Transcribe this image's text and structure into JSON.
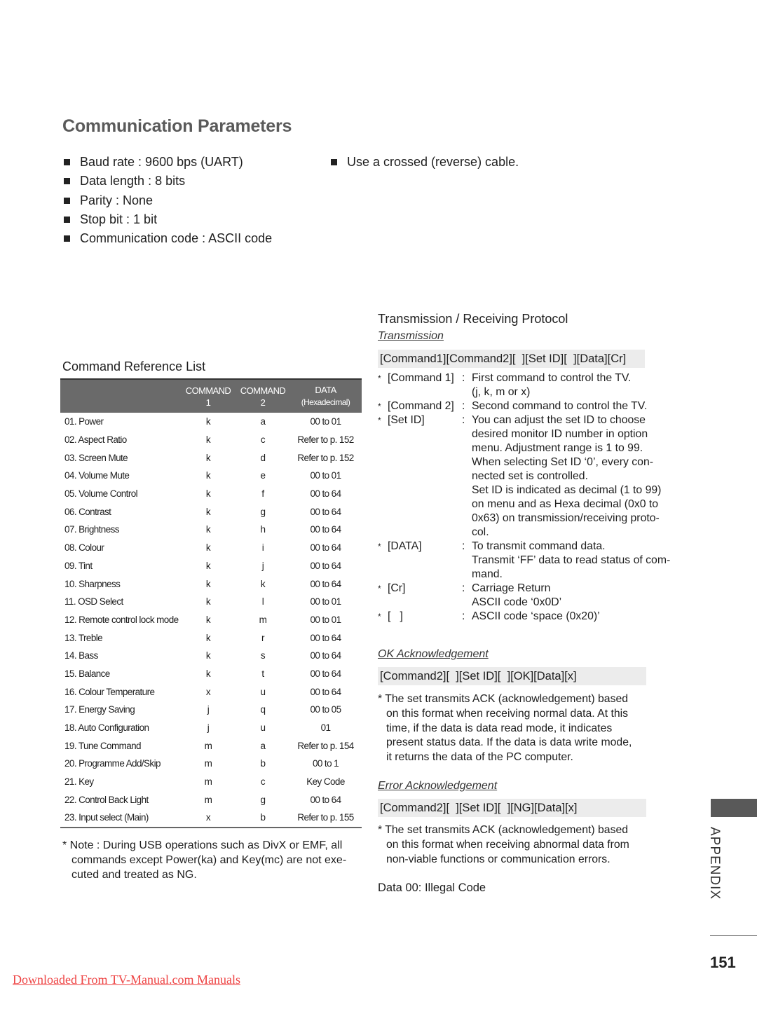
{
  "page": {
    "title": "Communication Parameters",
    "params": [
      "Baud rate : 9600 bps (UART)",
      "Data length : 8 bits",
      "Parity : None",
      "Stop bit : 1 bit",
      "Communication code : ASCII code"
    ],
    "cable_note": "Use a crossed (reverse) cable."
  },
  "command_reference": {
    "title": "Command Reference List",
    "headers": {
      "col0": "",
      "cmd1_line1": "COMMAND",
      "cmd1_line2": "1",
      "cmd2_line1": "COMMAND",
      "cmd2_line2": "2",
      "data_line1": "DATA",
      "data_line2": "(Hexadecimal)"
    },
    "rows": [
      {
        "name": "01. Power",
        "cmd1": "k",
        "cmd2": "a",
        "data": "00 to 01"
      },
      {
        "name": "02. Aspect Ratio",
        "cmd1": "k",
        "cmd2": "c",
        "data": "Refer to p. 152"
      },
      {
        "name": "03. Screen Mute",
        "cmd1": "k",
        "cmd2": "d",
        "data": "Refer to p. 152"
      },
      {
        "name": "04. Volume Mute",
        "cmd1": "k",
        "cmd2": "e",
        "data": "00 to 01"
      },
      {
        "name": "05. Volume Control",
        "cmd1": "k",
        "cmd2": "f",
        "data": "00 to 64"
      },
      {
        "name": "06. Contrast",
        "cmd1": "k",
        "cmd2": "g",
        "data": "00 to 64"
      },
      {
        "name": "07. Brightness",
        "cmd1": "k",
        "cmd2": "h",
        "data": "00 to 64"
      },
      {
        "name": "08. Colour",
        "cmd1": "k",
        "cmd2": "i",
        "data": "00 to 64"
      },
      {
        "name": "09. Tint",
        "cmd1": "k",
        "cmd2": "j",
        "data": "00 to 64"
      },
      {
        "name": "10. Sharpness",
        "cmd1": "k",
        "cmd2": "k",
        "data": "00 to 64"
      },
      {
        "name": "11. OSD Select",
        "cmd1": "k",
        "cmd2": "l",
        "data": "00 to 01"
      },
      {
        "name": "12. Remote control lock mode",
        "cmd1": "k",
        "cmd2": "m",
        "data": "00 to 01"
      },
      {
        "name": "13. Treble",
        "cmd1": "k",
        "cmd2": "r",
        "data": "00 to 64"
      },
      {
        "name": "14. Bass",
        "cmd1": "k",
        "cmd2": "s",
        "data": "00 to 64"
      },
      {
        "name": "15. Balance",
        "cmd1": "k",
        "cmd2": "t",
        "data": "00 to 64"
      },
      {
        "name": "16. Colour Temperature",
        "cmd1": "x",
        "cmd2": "u",
        "data": "00 to 64"
      },
      {
        "name": "17. Energy Saving",
        "cmd1": "j",
        "cmd2": "q",
        "data": "00 to 05"
      },
      {
        "name": "18. Auto Configuration",
        "cmd1": "j",
        "cmd2": "u",
        "data": "01"
      },
      {
        "name": "19. Tune Command",
        "cmd1": "m",
        "cmd2": "a",
        "data": "Refer to p. 154"
      },
      {
        "name": "20. Programme Add/Skip",
        "cmd1": "m",
        "cmd2": "b",
        "data": "00 to 1"
      },
      {
        "name": "21. Key",
        "cmd1": "m",
        "cmd2": "c",
        "data": "Key Code"
      },
      {
        "name": "22. Control Back Light",
        "cmd1": "m",
        "cmd2": "g",
        "data": "00 to 64"
      },
      {
        "name": "23. Input select (Main)",
        "cmd1": "x",
        "cmd2": "b",
        "data": "Refer to p. 155"
      }
    ],
    "note_line1": "* Note : During USB operations such as DivX or EMF, all",
    "note_line2": "commands except Power(ka) and Key(mc) are not exe-",
    "note_line3": "cuted and treated as NG."
  },
  "protocol": {
    "title": "Transmission / Receiving Protocol",
    "transmission_label": "Transmission",
    "transmission_format": "[Command1][Command2][  ][Set ID][  ][Data][Cr]",
    "definitions": [
      {
        "star": "*",
        "key": "[Command 1]",
        "colon": ":",
        "lines": [
          "First command to control the TV.",
          "(j, k, m or x)"
        ]
      },
      {
        "star": "*",
        "key": "[Command 2]",
        "colon": ":",
        "lines": [
          "Second command to control the TV."
        ]
      },
      {
        "star": "*",
        "key": "[Set ID]",
        "colon": ":",
        "lines": [
          "You can adjust the set ID to choose",
          "desired monitor ID number in option",
          "menu. Adjustment range is 1 to 99.",
          "When selecting Set ID ‘0’, every con-",
          "nected set is controlled.",
          "Set ID is indicated as decimal (1 to 99)",
          "on menu and as Hexa decimal (0x0 to",
          "0x63) on transmission/receiving proto-",
          "col."
        ]
      },
      {
        "star": "*",
        "key": "[DATA]",
        "colon": ":",
        "lines": [
          "To transmit command data.",
          "Transmit ‘FF’ data to read status of com-",
          "mand."
        ]
      },
      {
        "star": "*",
        "key": "[Cr]",
        "colon": ":",
        "lines": [
          "Carriage Return",
          "ASCII code ‘0x0D’"
        ]
      },
      {
        "star": "*",
        "key": "[   ]",
        "colon": ":",
        "lines": [
          "ASCII code ‘space (0x20)’"
        ]
      }
    ],
    "ok_label": "OK Acknowledgement",
    "ok_format": "[Command2][  ][Set ID][  ][OK][Data][x]",
    "ok_desc_line1": "* The set transmits ACK (acknowledgement) based",
    "ok_desc_rest": [
      "on this format when receiving normal data. At this",
      "time, if the data is data read mode, it indicates",
      "present status data. If the data is data write mode,",
      "it returns the data of the PC computer."
    ],
    "error_label": "Error Acknowledgement",
    "error_format": "[Command2][  ][Set ID][  ][NG][Data][x]",
    "error_desc_line1": "* The set transmits ACK (acknowledgement) based",
    "error_desc_rest": [
      "on this format when receiving abnormal data from",
      "non-viable functions or communication errors."
    ],
    "data_code": "Data 00: Illegal Code"
  },
  "side": {
    "section_label": "APPENDIX",
    "page_number": "151"
  },
  "footer": {
    "link_text": "Downloaded From TV-Manual.com Manuals"
  }
}
